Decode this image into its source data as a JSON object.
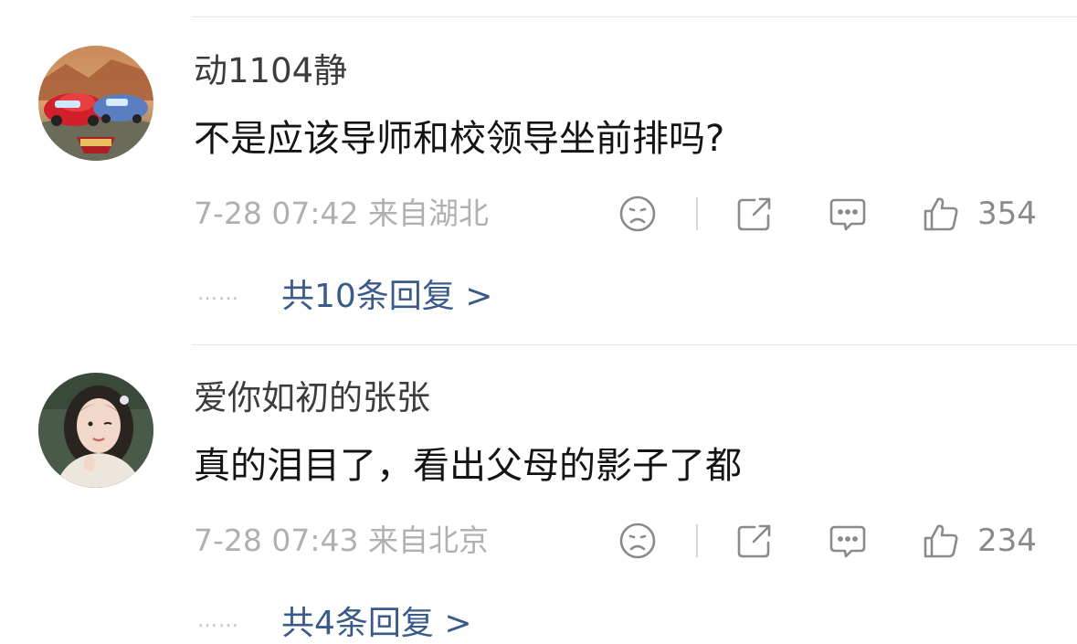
{
  "comments": [
    {
      "username": "动1104静",
      "text": "不是应该导师和校领导坐前排吗?",
      "meta": "7-28 07:42  来自湖北",
      "likes": "354",
      "replies_dots": "……",
      "replies_label": "共10条回复 >"
    },
    {
      "username": "爱你如初的张张",
      "text": "真的泪目了，看出父母的影子了都",
      "meta": "7-28 07:43  来自北京",
      "likes": "234",
      "replies_dots": "……",
      "replies_label": "共4条回复 >"
    }
  ],
  "icons": {
    "dislike": "sad-face-icon",
    "share": "share-icon",
    "comment": "comment-bubble-icon",
    "like": "thumbs-up-icon"
  },
  "colors": {
    "reply_link": "#3a5a8a",
    "meta_text": "#b0b0b0",
    "icon": "#8a8a8a"
  }
}
